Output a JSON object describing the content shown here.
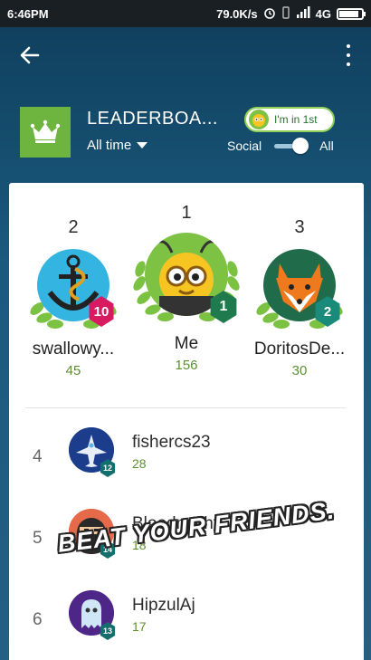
{
  "status_bar": {
    "time": "6:46PM",
    "speed": "79.0K/s",
    "network": "4G"
  },
  "appbar": {
    "back_icon": "arrow-left-icon",
    "menu_icon": "more-vert-icon"
  },
  "header": {
    "title": "LEADERBOA...",
    "filter_label": "All time",
    "pill_text": "I'm in 1st",
    "social_label": "Social",
    "all_label": "All",
    "toggle_on": true,
    "crown_color": "#6db53f"
  },
  "podium": [
    {
      "rank": "2",
      "name": "swallowy...",
      "score": "45",
      "level": "10",
      "badge_color": "#d81b60"
    },
    {
      "rank": "1",
      "name": "Me",
      "score": "156",
      "level": "1",
      "badge_color": "#1f7a4d"
    },
    {
      "rank": "3",
      "name": "DoritosDe...",
      "score": "30",
      "level": "2",
      "badge_color": "#1a8a7a"
    }
  ],
  "rows": [
    {
      "rank": "4",
      "name": "fishercs23",
      "score": "28",
      "level": "12"
    },
    {
      "rank": "5",
      "name": "Bloodnacht",
      "score": "18",
      "level": "14"
    },
    {
      "rank": "6",
      "name": "HipzulAj",
      "score": "17",
      "level": "13"
    }
  ],
  "overlay_text": "BEAT YOUR FRIENDS."
}
